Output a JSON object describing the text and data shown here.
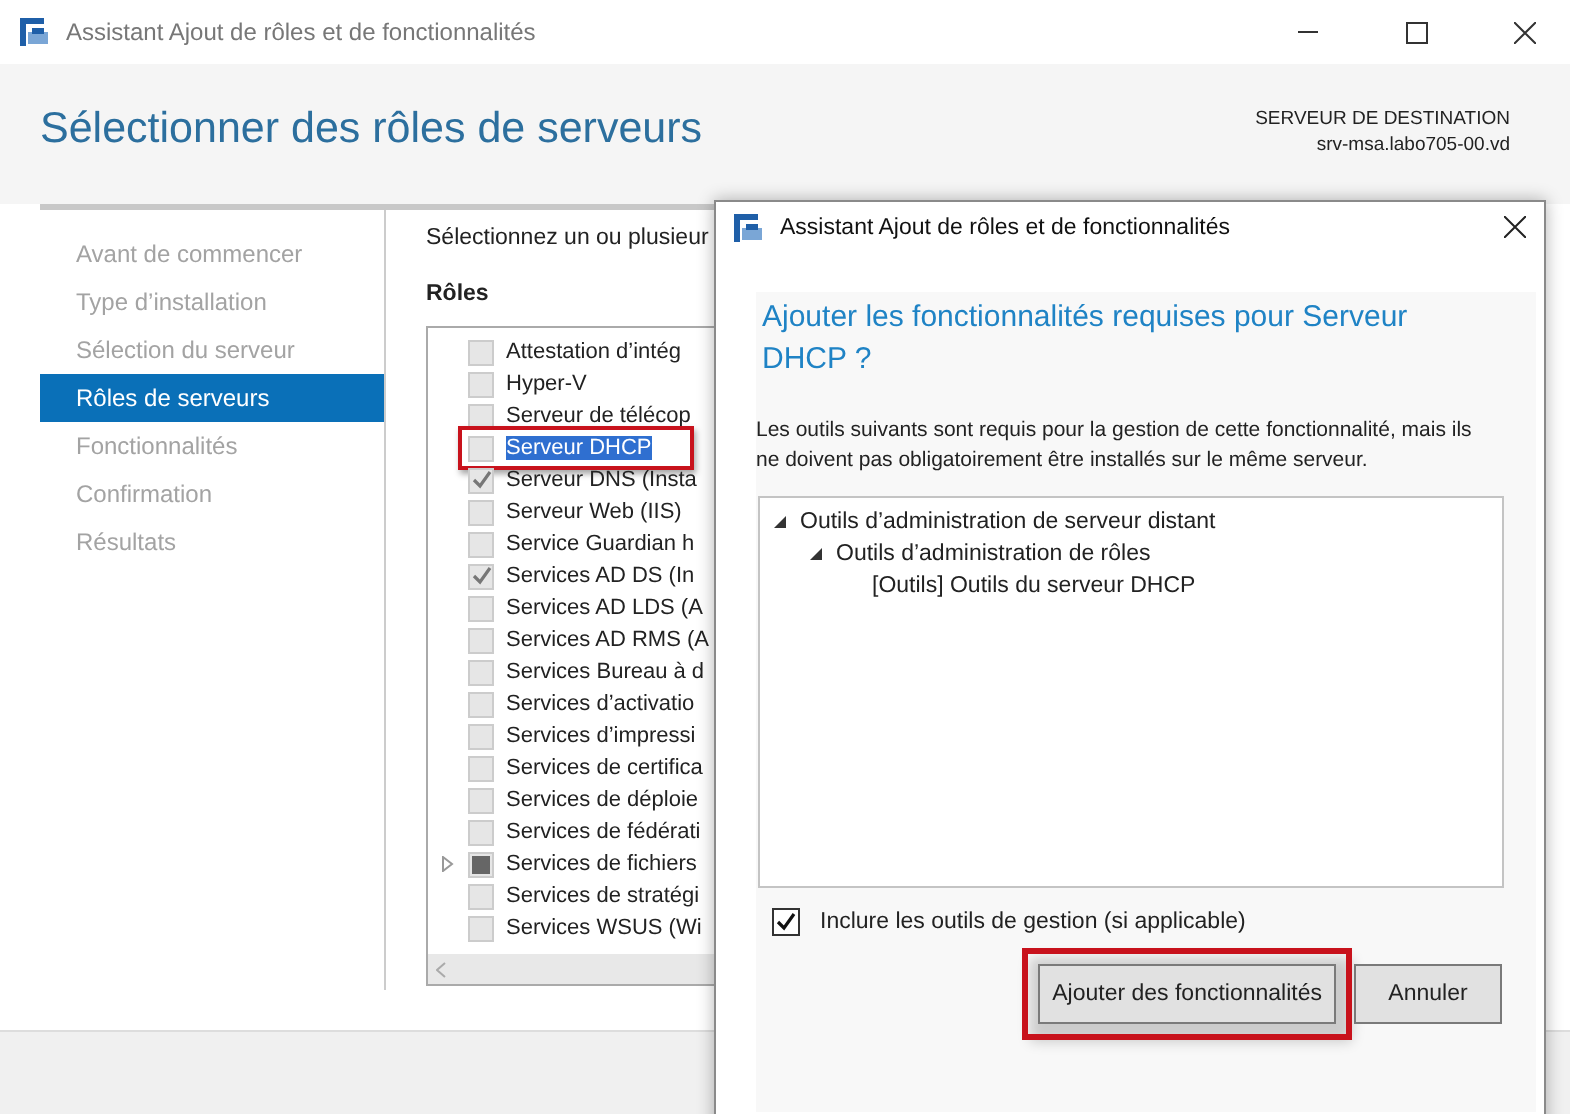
{
  "window": {
    "title": "Assistant Ajout de rôles et de fonctionnalités"
  },
  "header": {
    "title": "Sélectionner des rôles de serveurs",
    "destination_label": "SERVEUR DE DESTINATION",
    "destination_server": "srv-msa.labo705-00.vd"
  },
  "sidebar": {
    "items": [
      {
        "label": "Avant de commencer",
        "selected": false
      },
      {
        "label": "Type d’installation",
        "selected": false
      },
      {
        "label": "Sélection du serveur",
        "selected": false
      },
      {
        "label": "Rôles de serveurs",
        "selected": true
      },
      {
        "label": "Fonctionnalités",
        "selected": false
      },
      {
        "label": "Confirmation",
        "selected": false
      },
      {
        "label": "Résultats",
        "selected": false
      }
    ]
  },
  "content": {
    "instruction": "Sélectionnez un ou plusieur",
    "roles_label": "Rôles",
    "roles": [
      {
        "label": "Attestation d’intég",
        "checked": false,
        "partial": false,
        "expandable": false,
        "selected": false,
        "highlighted": false
      },
      {
        "label": "Hyper-V",
        "checked": false,
        "partial": false,
        "expandable": false,
        "selected": false,
        "highlighted": false
      },
      {
        "label": "Serveur de télécop",
        "checked": false,
        "partial": false,
        "expandable": false,
        "selected": false,
        "highlighted": false
      },
      {
        "label": "Serveur DHCP",
        "checked": false,
        "partial": false,
        "expandable": false,
        "selected": true,
        "highlighted": true
      },
      {
        "label": "Serveur DNS (Insta",
        "checked": true,
        "partial": false,
        "expandable": false,
        "selected": false,
        "highlighted": false
      },
      {
        "label": "Serveur Web (IIS)",
        "checked": false,
        "partial": false,
        "expandable": false,
        "selected": false,
        "highlighted": false
      },
      {
        "label": "Service Guardian h",
        "checked": false,
        "partial": false,
        "expandable": false,
        "selected": false,
        "highlighted": false
      },
      {
        "label": "Services AD DS (In",
        "checked": true,
        "partial": false,
        "expandable": false,
        "selected": false,
        "highlighted": false
      },
      {
        "label": "Services AD LDS (A",
        "checked": false,
        "partial": false,
        "expandable": false,
        "selected": false,
        "highlighted": false
      },
      {
        "label": "Services AD RMS (A",
        "checked": false,
        "partial": false,
        "expandable": false,
        "selected": false,
        "highlighted": false
      },
      {
        "label": "Services Bureau à d",
        "checked": false,
        "partial": false,
        "expandable": false,
        "selected": false,
        "highlighted": false
      },
      {
        "label": "Services d’activatio",
        "checked": false,
        "partial": false,
        "expandable": false,
        "selected": false,
        "highlighted": false
      },
      {
        "label": "Services d’impressi",
        "checked": false,
        "partial": false,
        "expandable": false,
        "selected": false,
        "highlighted": false
      },
      {
        "label": "Services de certifica",
        "checked": false,
        "partial": false,
        "expandable": false,
        "selected": false,
        "highlighted": false
      },
      {
        "label": "Services de déploie",
        "checked": false,
        "partial": false,
        "expandable": false,
        "selected": false,
        "highlighted": false
      },
      {
        "label": "Services de fédérati",
        "checked": false,
        "partial": false,
        "expandable": false,
        "selected": false,
        "highlighted": false
      },
      {
        "label": "Services de fichiers",
        "checked": false,
        "partial": true,
        "expandable": true,
        "selected": false,
        "highlighted": false
      },
      {
        "label": "Services de stratégi",
        "checked": false,
        "partial": false,
        "expandable": false,
        "selected": false,
        "highlighted": false
      },
      {
        "label": "Services WSUS (Wi",
        "checked": false,
        "partial": false,
        "expandable": false,
        "selected": false,
        "highlighted": false
      }
    ]
  },
  "dialog": {
    "title": "Assistant Ajout de rôles et de fonctionnalités",
    "heading": "Ajouter les fonctionnalités requises pour Serveur DHCP ?",
    "description": "Les outils suivants sont requis pour la gestion de cette fonctionnalité, mais ils ne doivent pas obligatoirement être installés sur le même serveur.",
    "tree": [
      {
        "label": "Outils d’administration de serveur distant",
        "expanded": true,
        "children": [
          {
            "label": "Outils d’administration de rôles",
            "expanded": true,
            "children": [
              {
                "label": "[Outils] Outils du serveur DHCP"
              }
            ]
          }
        ]
      }
    ],
    "include_tools": {
      "label": "Inclure les outils de gestion (si applicable)",
      "checked": true
    },
    "buttons": [
      {
        "label": "Ajouter des fonctionnalités",
        "highlighted": true
      },
      {
        "label": "Annuler",
        "highlighted": false
      }
    ]
  }
}
